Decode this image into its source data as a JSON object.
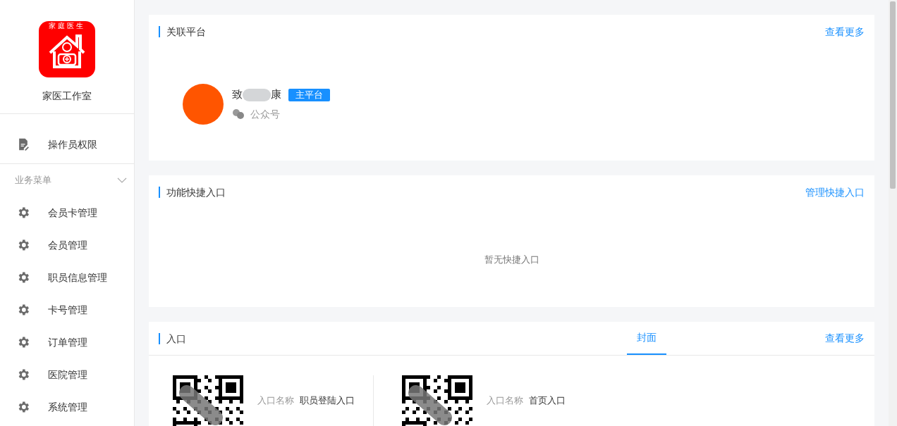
{
  "sidebar": {
    "app_name": "家医工作室",
    "logo_caption": "家庭医生",
    "top_items": [
      {
        "label": "操作员权限",
        "kind": "document"
      }
    ],
    "section": {
      "label": "业务菜单",
      "expanded": true
    },
    "items": [
      {
        "label": "会员卡管理",
        "kind": "gear"
      },
      {
        "label": "会员管理",
        "kind": "gear"
      },
      {
        "label": "职员信息管理",
        "kind": "gear"
      },
      {
        "label": "卡号管理",
        "kind": "gear"
      },
      {
        "label": "订单管理",
        "kind": "gear"
      },
      {
        "label": "医院管理",
        "kind": "gear"
      },
      {
        "label": "系统管理",
        "kind": "gear"
      }
    ]
  },
  "platform_card": {
    "title": "关联平台",
    "more_link": "查看更多",
    "account": {
      "name_start": "致",
      "name_end": "康",
      "badge": "主平台",
      "type": "公众号"
    }
  },
  "shortcut_card": {
    "title": "功能快捷入口",
    "manage_link": "管理快捷入口",
    "empty_text": "暂无快捷入口"
  },
  "entry_card": {
    "title": "入口",
    "tabs": [
      {
        "label": "封面",
        "selected": true
      }
    ],
    "more_link": "查看更多",
    "entries": [
      {
        "label": "入口名称",
        "value": "职员登陆入口"
      },
      {
        "label": "入口名称",
        "value": "首页入口"
      }
    ]
  }
}
